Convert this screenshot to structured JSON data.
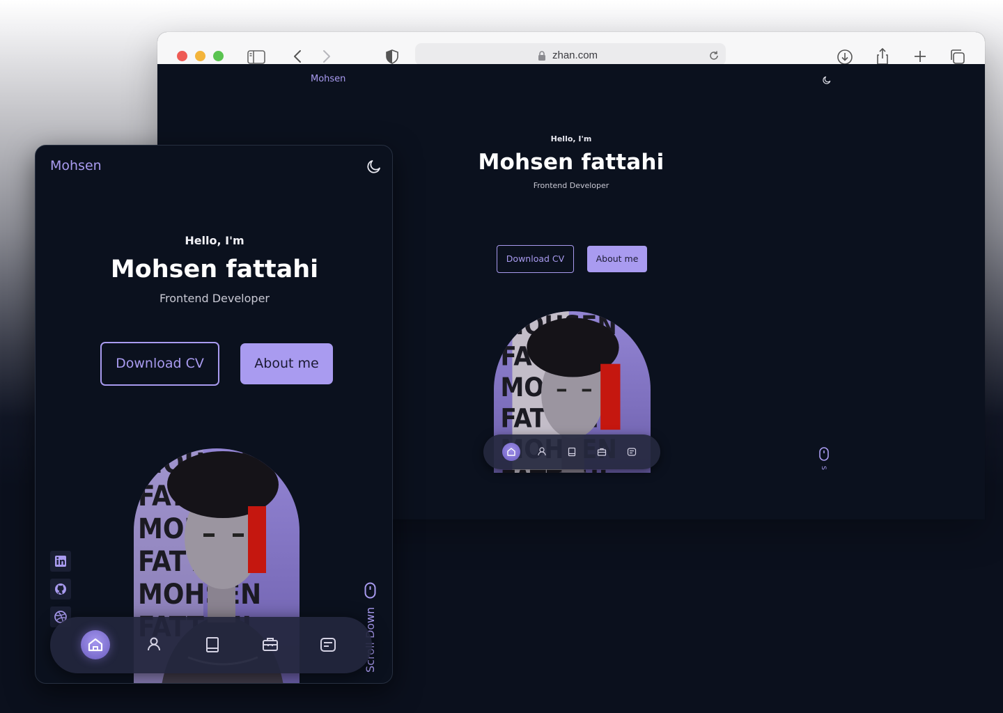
{
  "browser": {
    "url": "zhan.com"
  },
  "site": {
    "logo": "Mohsen",
    "greeting": "Hello, I'm",
    "name": "Mohsen fattahi",
    "role": "Frontend Developer",
    "buttons": {
      "download_cv": "Download CV",
      "about_me": "About me"
    },
    "scroll_label": "Scroll Down",
    "scroll_label_visible_fragment_desktop": "S",
    "nav_items": [
      "home-icon",
      "user-icon",
      "book-icon",
      "briefcase-icon",
      "message-icon"
    ],
    "social_icons": [
      "linkedin-icon",
      "github-icon",
      "dribbble-icon"
    ],
    "poster_words": [
      "MOHSEN",
      "FATTAHI",
      "MOHSEN",
      "FATTAHI",
      "MOHSEN",
      "FATTAHI"
    ]
  },
  "colors": {
    "accent": "#a99bf0",
    "background": "#0b111e",
    "nav_background": "#22263c",
    "photo_accent_red": "#c5170f"
  }
}
